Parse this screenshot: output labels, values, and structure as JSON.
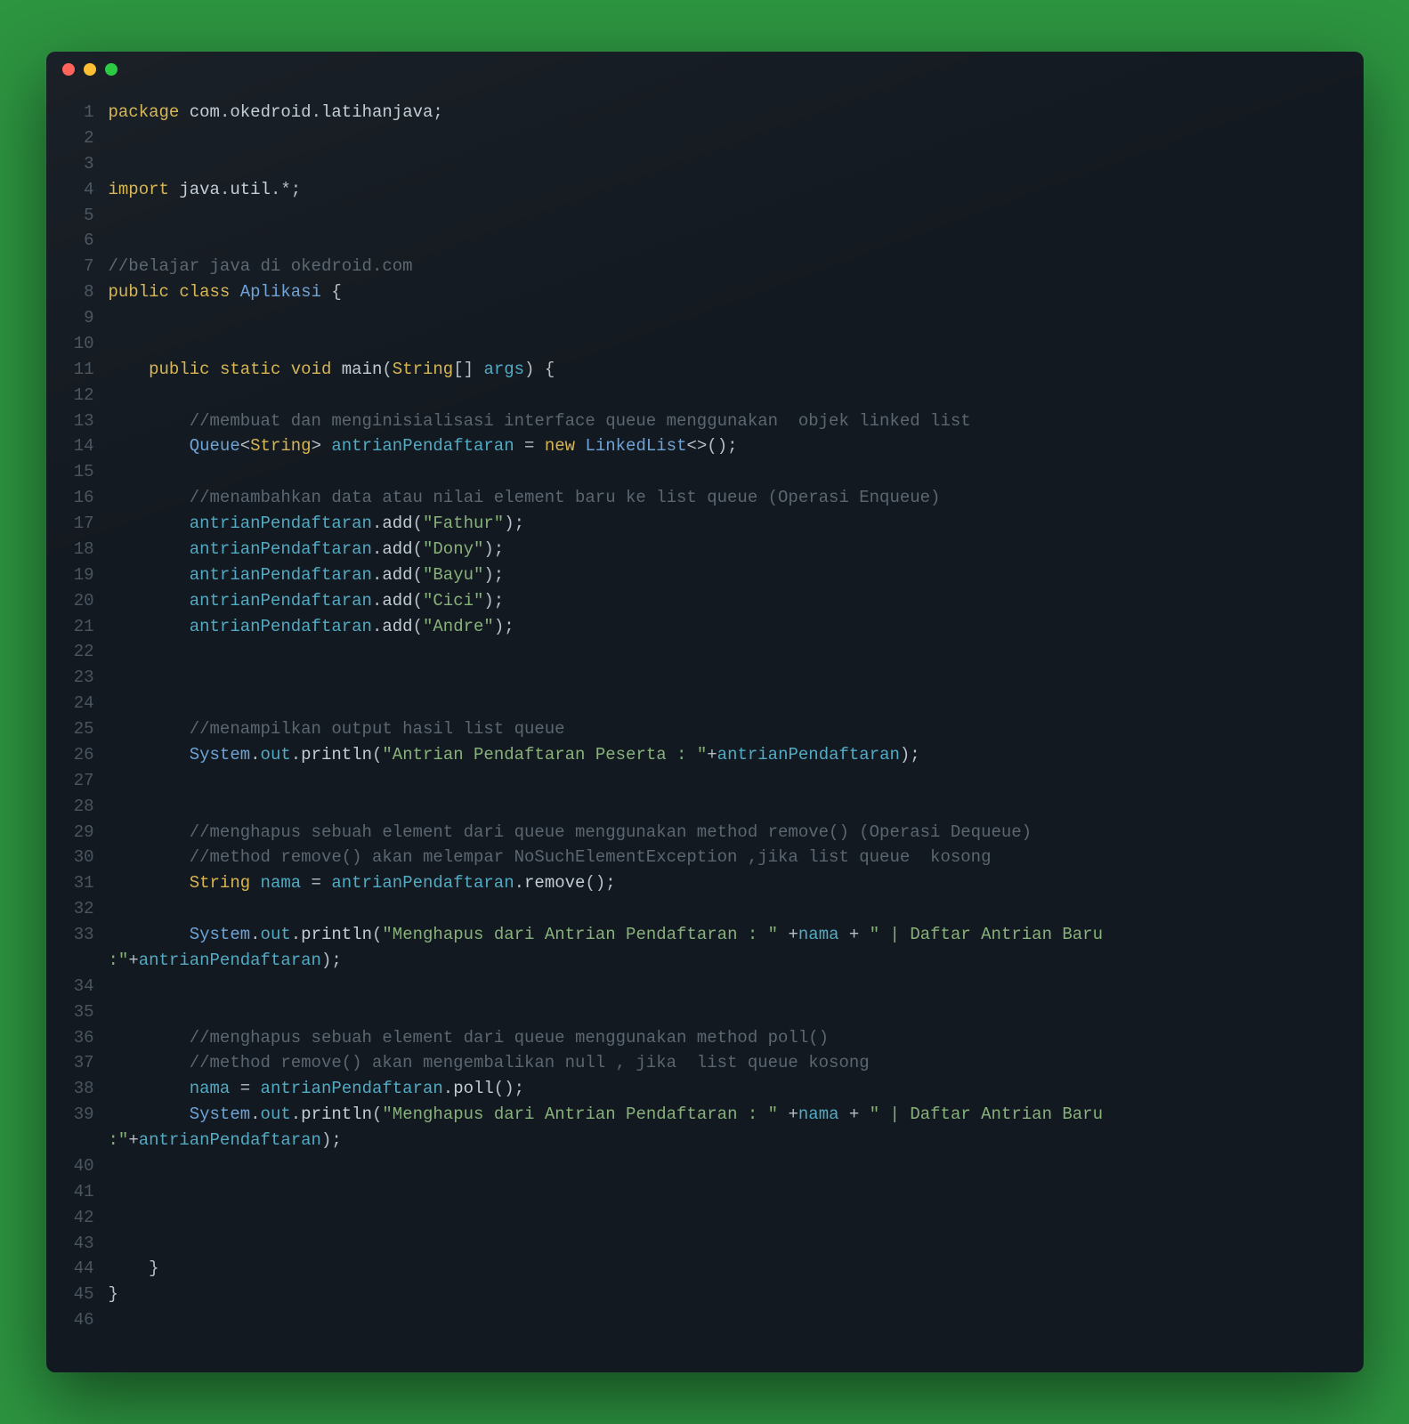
{
  "colors": {
    "page_bg": "#2d9440",
    "window_bg": "#131920",
    "traffic_red": "#ff5f56",
    "traffic_yellow": "#ffbd2e",
    "traffic_green": "#27c93f",
    "keyword": "#d6b552",
    "type": "#6fa3d6",
    "variable": "#52aac3",
    "string": "#88b17b",
    "comment": "#5b6670",
    "default": "#c3cdd6",
    "gutter": "#4a5560"
  },
  "code": [
    {
      "n": 1,
      "t": [
        [
          "kw",
          "package"
        ],
        [
          "punc",
          " "
        ],
        [
          "pkg",
          "com"
        ],
        [
          "punc",
          "."
        ],
        [
          "pkg",
          "okedroid"
        ],
        [
          "punc",
          "."
        ],
        [
          "pkg",
          "latihanjava"
        ],
        [
          "punc",
          ";"
        ]
      ]
    },
    {
      "n": 2,
      "t": []
    },
    {
      "n": 3,
      "t": []
    },
    {
      "n": 4,
      "t": [
        [
          "kw",
          "import"
        ],
        [
          "punc",
          " "
        ],
        [
          "pkg",
          "java"
        ],
        [
          "punc",
          "."
        ],
        [
          "pkg",
          "util"
        ],
        [
          "punc",
          ".*;"
        ]
      ]
    },
    {
      "n": 5,
      "t": []
    },
    {
      "n": 6,
      "t": []
    },
    {
      "n": 7,
      "t": [
        [
          "comment",
          "//belajar java di okedroid.com"
        ]
      ]
    },
    {
      "n": 8,
      "t": [
        [
          "kw",
          "public"
        ],
        [
          "punc",
          " "
        ],
        [
          "kw",
          "class"
        ],
        [
          "punc",
          " "
        ],
        [
          "type",
          "Aplikasi"
        ],
        [
          "punc",
          " {"
        ]
      ]
    },
    {
      "n": 9,
      "t": []
    },
    {
      "n": 10,
      "t": []
    },
    {
      "n": 11,
      "t": [
        [
          "punc",
          "    "
        ],
        [
          "kw",
          "public"
        ],
        [
          "punc",
          " "
        ],
        [
          "kw",
          "static"
        ],
        [
          "punc",
          " "
        ],
        [
          "kw",
          "void"
        ],
        [
          "punc",
          " "
        ],
        [
          "method",
          "main"
        ],
        [
          "punc",
          "("
        ],
        [
          "typeY",
          "String"
        ],
        [
          "punc",
          "[] "
        ],
        [
          "var",
          "args"
        ],
        [
          "punc",
          ") {"
        ]
      ]
    },
    {
      "n": 12,
      "t": []
    },
    {
      "n": 13,
      "t": [
        [
          "punc",
          "        "
        ],
        [
          "comment",
          "//membuat dan menginisialisasi interface queue menggunakan  objek linked list"
        ]
      ]
    },
    {
      "n": 14,
      "t": [
        [
          "punc",
          "        "
        ],
        [
          "type",
          "Queue"
        ],
        [
          "punc",
          "<"
        ],
        [
          "typeY",
          "String"
        ],
        [
          "punc",
          "> "
        ],
        [
          "var",
          "antrianPendaftaran"
        ],
        [
          "punc",
          " = "
        ],
        [
          "kw",
          "new"
        ],
        [
          "punc",
          " "
        ],
        [
          "type",
          "LinkedList"
        ],
        [
          "punc",
          "<>();"
        ]
      ]
    },
    {
      "n": 15,
      "t": []
    },
    {
      "n": 16,
      "t": [
        [
          "punc",
          "        "
        ],
        [
          "comment",
          "//menambahkan data atau nilai element baru ke list queue (Operasi Enqueue)"
        ]
      ]
    },
    {
      "n": 17,
      "t": [
        [
          "punc",
          "        "
        ],
        [
          "var",
          "antrianPendaftaran"
        ],
        [
          "punc",
          "."
        ],
        [
          "method",
          "add"
        ],
        [
          "punc",
          "("
        ],
        [
          "str",
          "\"Fathur\""
        ],
        [
          "punc",
          ");"
        ]
      ]
    },
    {
      "n": 18,
      "t": [
        [
          "punc",
          "        "
        ],
        [
          "var",
          "antrianPendaftaran"
        ],
        [
          "punc",
          "."
        ],
        [
          "method",
          "add"
        ],
        [
          "punc",
          "("
        ],
        [
          "str",
          "\"Dony\""
        ],
        [
          "punc",
          ");"
        ]
      ]
    },
    {
      "n": 19,
      "t": [
        [
          "punc",
          "        "
        ],
        [
          "var",
          "antrianPendaftaran"
        ],
        [
          "punc",
          "."
        ],
        [
          "method",
          "add"
        ],
        [
          "punc",
          "("
        ],
        [
          "str",
          "\"Bayu\""
        ],
        [
          "punc",
          ");"
        ]
      ]
    },
    {
      "n": 20,
      "t": [
        [
          "punc",
          "        "
        ],
        [
          "var",
          "antrianPendaftaran"
        ],
        [
          "punc",
          "."
        ],
        [
          "method",
          "add"
        ],
        [
          "punc",
          "("
        ],
        [
          "str",
          "\"Cici\""
        ],
        [
          "punc",
          ");"
        ]
      ]
    },
    {
      "n": 21,
      "t": [
        [
          "punc",
          "        "
        ],
        [
          "var",
          "antrianPendaftaran"
        ],
        [
          "punc",
          "."
        ],
        [
          "method",
          "add"
        ],
        [
          "punc",
          "("
        ],
        [
          "str",
          "\"Andre\""
        ],
        [
          "punc",
          ");"
        ]
      ]
    },
    {
      "n": 22,
      "t": []
    },
    {
      "n": 23,
      "t": []
    },
    {
      "n": 24,
      "t": []
    },
    {
      "n": 25,
      "t": [
        [
          "punc",
          "        "
        ],
        [
          "comment",
          "//menampilkan output hasil list queue"
        ]
      ]
    },
    {
      "n": 26,
      "t": [
        [
          "punc",
          "        "
        ],
        [
          "type",
          "System"
        ],
        [
          "punc",
          "."
        ],
        [
          "var",
          "out"
        ],
        [
          "punc",
          "."
        ],
        [
          "method",
          "println"
        ],
        [
          "punc",
          "("
        ],
        [
          "str",
          "\"Antrian Pendaftaran Peserta : \""
        ],
        [
          "punc",
          "+"
        ],
        [
          "var",
          "antrianPendaftaran"
        ],
        [
          "punc",
          ");"
        ]
      ]
    },
    {
      "n": 27,
      "t": []
    },
    {
      "n": 28,
      "t": []
    },
    {
      "n": 29,
      "t": [
        [
          "punc",
          "        "
        ],
        [
          "comment",
          "//menghapus sebuah element dari queue menggunakan method remove() (Operasi Dequeue)"
        ]
      ]
    },
    {
      "n": 30,
      "t": [
        [
          "punc",
          "        "
        ],
        [
          "comment",
          "//method remove() akan melempar NoSuchElementException ,jika list queue  kosong"
        ]
      ]
    },
    {
      "n": 31,
      "t": [
        [
          "punc",
          "        "
        ],
        [
          "typeY",
          "String"
        ],
        [
          "punc",
          " "
        ],
        [
          "var",
          "nama"
        ],
        [
          "punc",
          " = "
        ],
        [
          "var",
          "antrianPendaftaran"
        ],
        [
          "punc",
          "."
        ],
        [
          "method",
          "remove"
        ],
        [
          "punc",
          "();"
        ]
      ]
    },
    {
      "n": 32,
      "t": []
    },
    {
      "n": 33,
      "t": [
        [
          "punc",
          "        "
        ],
        [
          "type",
          "System"
        ],
        [
          "punc",
          "."
        ],
        [
          "var",
          "out"
        ],
        [
          "punc",
          "."
        ],
        [
          "method",
          "println"
        ],
        [
          "punc",
          "("
        ],
        [
          "str",
          "\"Menghapus dari Antrian Pendaftaran : \""
        ],
        [
          "punc",
          " +"
        ],
        [
          "var",
          "nama"
        ],
        [
          "punc",
          " + "
        ],
        [
          "str",
          "\" | Daftar Antrian Baru :\""
        ],
        [
          "punc",
          "+"
        ],
        [
          "var",
          "antrianPendaftaran"
        ],
        [
          "punc",
          ");"
        ]
      ]
    },
    {
      "n": 34,
      "t": []
    },
    {
      "n": 35,
      "t": []
    },
    {
      "n": 36,
      "t": [
        [
          "punc",
          "        "
        ],
        [
          "comment",
          "//menghapus sebuah element dari queue menggunakan method poll()"
        ]
      ]
    },
    {
      "n": 37,
      "t": [
        [
          "punc",
          "        "
        ],
        [
          "comment",
          "//method remove() akan mengembalikan null , jika  list queue kosong"
        ]
      ]
    },
    {
      "n": 38,
      "t": [
        [
          "punc",
          "        "
        ],
        [
          "var",
          "nama"
        ],
        [
          "punc",
          " = "
        ],
        [
          "var",
          "antrianPendaftaran"
        ],
        [
          "punc",
          "."
        ],
        [
          "method",
          "poll"
        ],
        [
          "punc",
          "();"
        ]
      ]
    },
    {
      "n": 39,
      "t": [
        [
          "punc",
          "        "
        ],
        [
          "type",
          "System"
        ],
        [
          "punc",
          "."
        ],
        [
          "var",
          "out"
        ],
        [
          "punc",
          "."
        ],
        [
          "method",
          "println"
        ],
        [
          "punc",
          "("
        ],
        [
          "str",
          "\"Menghapus dari Antrian Pendaftaran : \""
        ],
        [
          "punc",
          " +"
        ],
        [
          "var",
          "nama"
        ],
        [
          "punc",
          " + "
        ],
        [
          "str",
          "\" | Daftar Antrian Baru :\""
        ],
        [
          "punc",
          "+"
        ],
        [
          "var",
          "antrianPendaftaran"
        ],
        [
          "punc",
          ");"
        ]
      ]
    },
    {
      "n": 40,
      "t": []
    },
    {
      "n": 41,
      "t": []
    },
    {
      "n": 42,
      "t": []
    },
    {
      "n": 43,
      "t": []
    },
    {
      "n": 44,
      "t": [
        [
          "punc",
          "    }"
        ]
      ]
    },
    {
      "n": 45,
      "t": [
        [
          "punc",
          "}"
        ]
      ]
    },
    {
      "n": 46,
      "t": []
    }
  ]
}
